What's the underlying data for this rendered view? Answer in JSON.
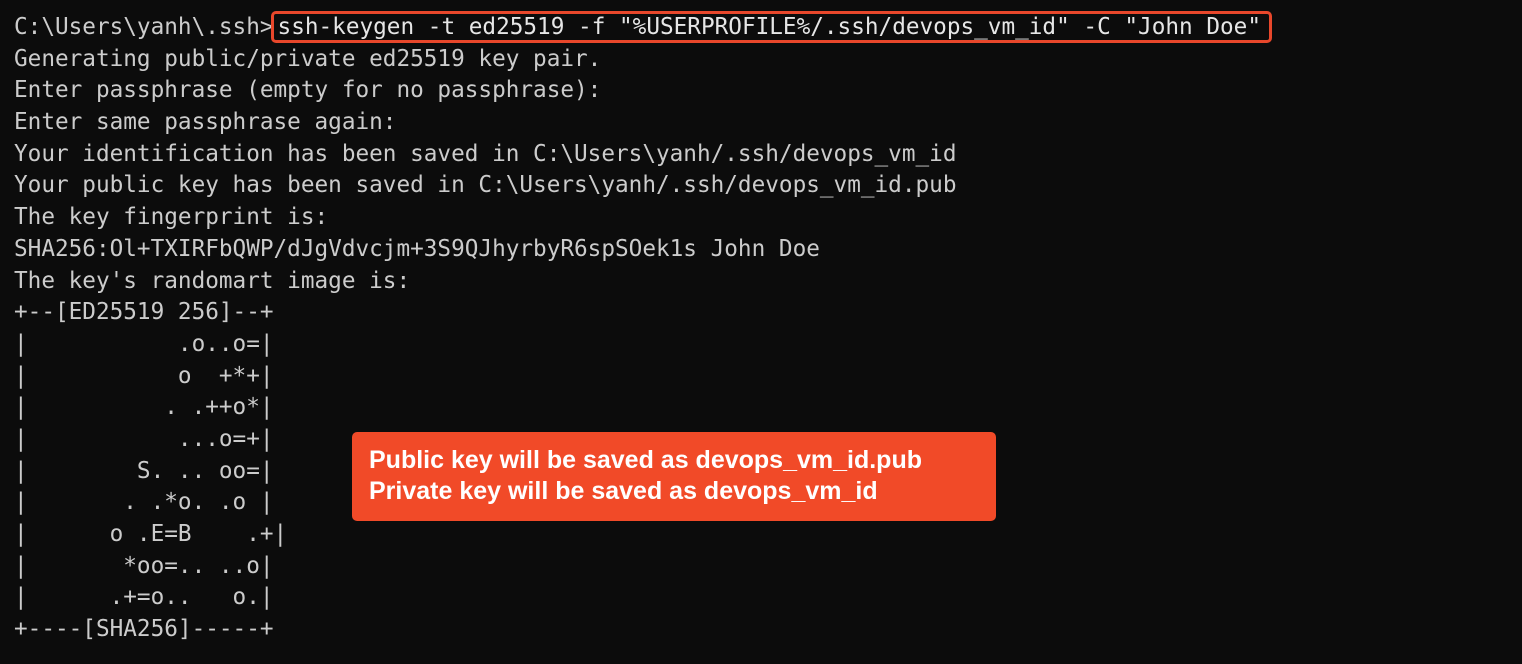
{
  "terminal": {
    "prompt": "C:\\Users\\yanh\\.ssh>",
    "command": "ssh-keygen -t ed25519 -f \"%USERPROFILE%/.ssh/devops_vm_id\" -C \"John Doe\"",
    "output_lines": [
      "Generating public/private ed25519 key pair.",
      "Enter passphrase (empty for no passphrase):",
      "Enter same passphrase again:",
      "Your identification has been saved in C:\\Users\\yanh/.ssh/devops_vm_id",
      "Your public key has been saved in C:\\Users\\yanh/.ssh/devops_vm_id.pub",
      "The key fingerprint is:",
      "SHA256:Ol+TXIRFbQWP/dJgVdvcjm+3S9QJhyrbyR6spSOek1s John Doe",
      "The key's randomart image is:",
      "+--[ED25519 256]--+",
      "|           .o..o=|",
      "|           o  +*+|",
      "|          . .++o*|",
      "|           ...o=+|",
      "|        S. .. oo=|",
      "|       . .*o. .o |",
      "|      o .E=B    .+|",
      "|       *oo=.. ..o|",
      "|      .+=o..   o.|",
      "+----[SHA256]-----+"
    ]
  },
  "callout": {
    "line1": "Public key will be saved as devops_vm_id.pub",
    "line2": "Private key will be saved as devops_vm_id"
  },
  "colors": {
    "background": "#0c0c0c",
    "text": "#cccccc",
    "highlight": "#e8472b",
    "callout_background": "#f14a28"
  }
}
